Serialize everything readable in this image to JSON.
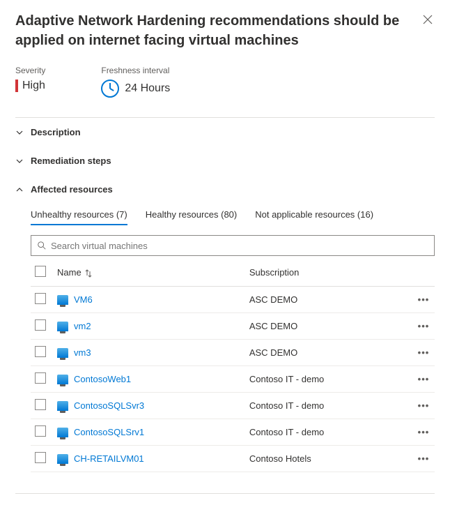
{
  "title": "Adaptive Network Hardening recommendations should be applied on internet facing virtual machines",
  "meta": {
    "severity_label": "Severity",
    "severity_value": "High",
    "freshness_label": "Freshness interval",
    "freshness_value": "24 Hours"
  },
  "sections": {
    "description": "Description",
    "remediation": "Remediation steps",
    "affected": "Affected resources"
  },
  "tabs": {
    "unhealthy": "Unhealthy resources (7)",
    "healthy": "Healthy resources (80)",
    "not_applicable": "Not applicable resources (16)"
  },
  "search": {
    "placeholder": "Search virtual machines"
  },
  "columns": {
    "name": "Name",
    "subscription": "Subscription"
  },
  "rows": [
    {
      "name": "VM6",
      "subscription": "ASC DEMO"
    },
    {
      "name": "vm2",
      "subscription": "ASC DEMO"
    },
    {
      "name": "vm3",
      "subscription": "ASC DEMO"
    },
    {
      "name": "ContosoWeb1",
      "subscription": "Contoso IT - demo"
    },
    {
      "name": "ContosoSQLSvr3",
      "subscription": "Contoso IT - demo"
    },
    {
      "name": "ContosoSQLSrv1",
      "subscription": "Contoso IT - demo"
    },
    {
      "name": "CH-RETAILVM01",
      "subscription": "Contoso Hotels"
    }
  ]
}
